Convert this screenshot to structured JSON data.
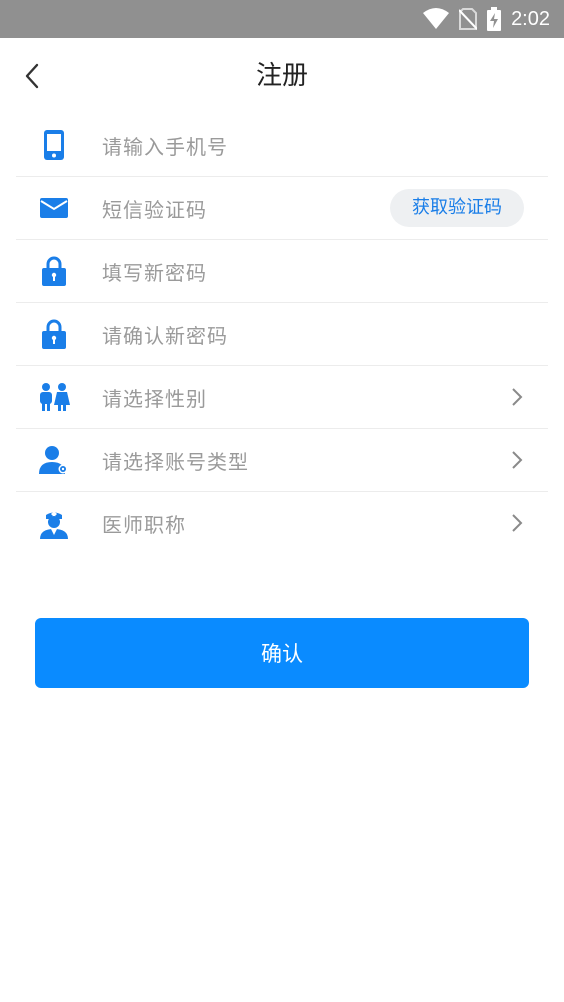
{
  "status_bar": {
    "time": "2:02"
  },
  "nav": {
    "title": "注册"
  },
  "form": {
    "phone_placeholder": "请输入手机号",
    "sms_placeholder": "短信验证码",
    "get_code_label": "获取验证码",
    "new_password_placeholder": "填写新密码",
    "confirm_password_placeholder": "请确认新密码",
    "gender_label": "请选择性别",
    "account_type_label": "请选择账号类型",
    "doctor_title_label": "医师职称"
  },
  "confirm_label": "确认",
  "colors": {
    "accent": "#0a8bff",
    "icon_blue": "#1a7ee8",
    "status_bar": "#909090",
    "placeholder": "#9a9a9a"
  },
  "icons": [
    "wifi-icon",
    "no-sim-icon",
    "battery-charging-icon",
    "back-arrow-icon",
    "phone-icon",
    "mail-icon",
    "lock-icon",
    "gender-icon",
    "user-card-icon",
    "doctor-icon",
    "chevron-right-icon"
  ]
}
